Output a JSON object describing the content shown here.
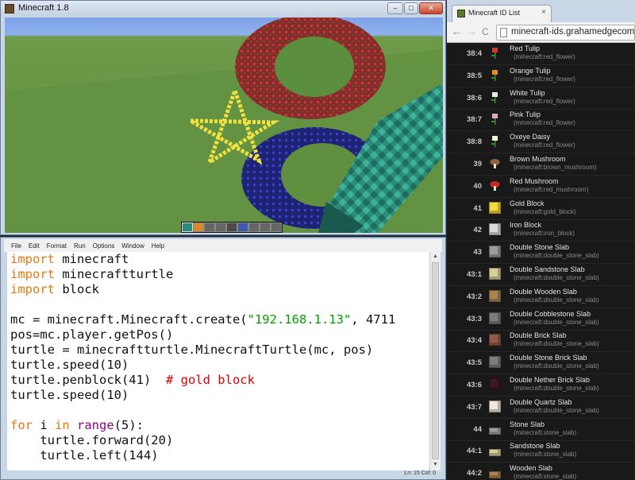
{
  "minecraft_window": {
    "title": "Minecraft 1.8",
    "minimize": "–",
    "maximize": "□",
    "close": "✕"
  },
  "idle": {
    "menu": [
      "File",
      "Edit",
      "Format",
      "Run",
      "Options",
      "Window",
      "Help"
    ],
    "status": "Ln: 15  Col: 0",
    "code_lines": [
      [
        {
          "t": "import",
          "c": "kw"
        },
        {
          "t": " minecraft",
          "c": ""
        }
      ],
      [
        {
          "t": "import",
          "c": "kw"
        },
        {
          "t": " minecraftturtle",
          "c": ""
        }
      ],
      [
        {
          "t": "import",
          "c": "kw"
        },
        {
          "t": " block",
          "c": ""
        }
      ],
      [],
      [
        {
          "t": "mc = minecraft.Minecraft.create(",
          "c": ""
        },
        {
          "t": "\"192.168.1.13\"",
          "c": "str"
        },
        {
          "t": ", 4711",
          "c": ""
        }
      ],
      [
        {
          "t": "pos=mc.player.getPos()",
          "c": ""
        }
      ],
      [
        {
          "t": "turtle = minecraftturtle.MinecraftTurtle(mc, pos)",
          "c": ""
        }
      ],
      [
        {
          "t": "turtle.speed(10)",
          "c": ""
        }
      ],
      [
        {
          "t": "turtle.penblock(41)  ",
          "c": ""
        },
        {
          "t": "# gold block",
          "c": "cm"
        }
      ],
      [
        {
          "t": "turtle.speed(10)",
          "c": ""
        }
      ],
      [],
      [
        {
          "t": "for",
          "c": "kw"
        },
        {
          "t": " i ",
          "c": ""
        },
        {
          "t": "in",
          "c": "kw"
        },
        {
          "t": " ",
          "c": ""
        },
        {
          "t": "range",
          "c": "bi"
        },
        {
          "t": "(5):",
          "c": ""
        }
      ],
      [
        {
          "t": "    turtle.forward(20)",
          "c": ""
        }
      ],
      [
        {
          "t": "    turtle.left(144)",
          "c": ""
        }
      ]
    ]
  },
  "browser": {
    "tab_title": "Minecraft ID List",
    "tab_close": "×",
    "back": "←",
    "forward": "→",
    "reload": "C",
    "url": "minecraft-ids.grahamedgecombe.com"
  },
  "id_list": [
    {
      "id": "38:4",
      "name": "Red Tulip",
      "tag": "(minecraft:red_flower)",
      "icon": "flower",
      "color": "#d23a2a"
    },
    {
      "id": "38:5",
      "name": "Orange Tulip",
      "tag": "(minecraft:red_flower)",
      "icon": "flower",
      "color": "#e58a1f"
    },
    {
      "id": "38:6",
      "name": "White Tulip",
      "tag": "(minecraft:red_flower)",
      "icon": "flower",
      "color": "#e8e8e8"
    },
    {
      "id": "38:7",
      "name": "Pink Tulip",
      "tag": "(minecraft:red_flower)",
      "icon": "flower",
      "color": "#e9a3c4"
    },
    {
      "id": "38:8",
      "name": "Oxeye Daisy",
      "tag": "(minecraft:red_flower)",
      "icon": "flower",
      "color": "#f2f2dc"
    },
    {
      "id": "39",
      "name": "Brown Mushroom",
      "tag": "(minecraft:brown_mushroom)",
      "icon": "mushroom",
      "color": "#8a6444"
    },
    {
      "id": "40",
      "name": "Red Mushroom",
      "tag": "(minecraft:red_mushroom)",
      "icon": "mushroom",
      "color": "#c92a1e"
    },
    {
      "id": "41",
      "name": "Gold Block",
      "tag": "(minecraft:gold_block)",
      "icon": "block",
      "color": "#f3d93c"
    },
    {
      "id": "42",
      "name": "Iron Block",
      "tag": "(minecraft:iron_block)",
      "icon": "block",
      "color": "#dcdcdc"
    },
    {
      "id": "43",
      "name": "Double Stone Slab",
      "tag": "(minecraft:double_stone_slab)",
      "icon": "block",
      "color": "#9d9d9d"
    },
    {
      "id": "43:1",
      "name": "Double Sandstone Slab",
      "tag": "(minecraft:double_stone_slab)",
      "icon": "block",
      "color": "#d9cf9b"
    },
    {
      "id": "43:2",
      "name": "Double Wooden Slab",
      "tag": "(minecraft:double_stone_slab)",
      "icon": "block",
      "color": "#a8844f"
    },
    {
      "id": "43:3",
      "name": "Double Cobblestone Slab",
      "tag": "(minecraft:double_stone_slab)",
      "icon": "block",
      "color": "#7c7c7c"
    },
    {
      "id": "43:4",
      "name": "Double Brick Slab",
      "tag": "(minecraft:double_stone_slab)",
      "icon": "block",
      "color": "#955a4a"
    },
    {
      "id": "43:5",
      "name": "Double Stone Brick Slab",
      "tag": "(minecraft:double_stone_slab)",
      "icon": "block",
      "color": "#7e7e7e"
    },
    {
      "id": "43:6",
      "name": "Double Nether Brick Slab",
      "tag": "(minecraft:double_stone_slab)",
      "icon": "block",
      "color": "#3a1a1e"
    },
    {
      "id": "43:7",
      "name": "Double Quartz Slab",
      "tag": "(minecraft:double_stone_slab)",
      "icon": "block",
      "color": "#ece8e0"
    },
    {
      "id": "44",
      "name": "Stone Slab",
      "tag": "(minecraft:stone_slab)",
      "icon": "slab",
      "color": "#a0a0a0"
    },
    {
      "id": "44:1",
      "name": "Sandstone Slab",
      "tag": "(minecraft:stone_slab)",
      "icon": "slab",
      "color": "#d9cf9b"
    },
    {
      "id": "44:2",
      "name": "Wooden Slab",
      "tag": "(minecraft:stone_slab)",
      "icon": "slab",
      "color": "#a8844f"
    }
  ]
}
